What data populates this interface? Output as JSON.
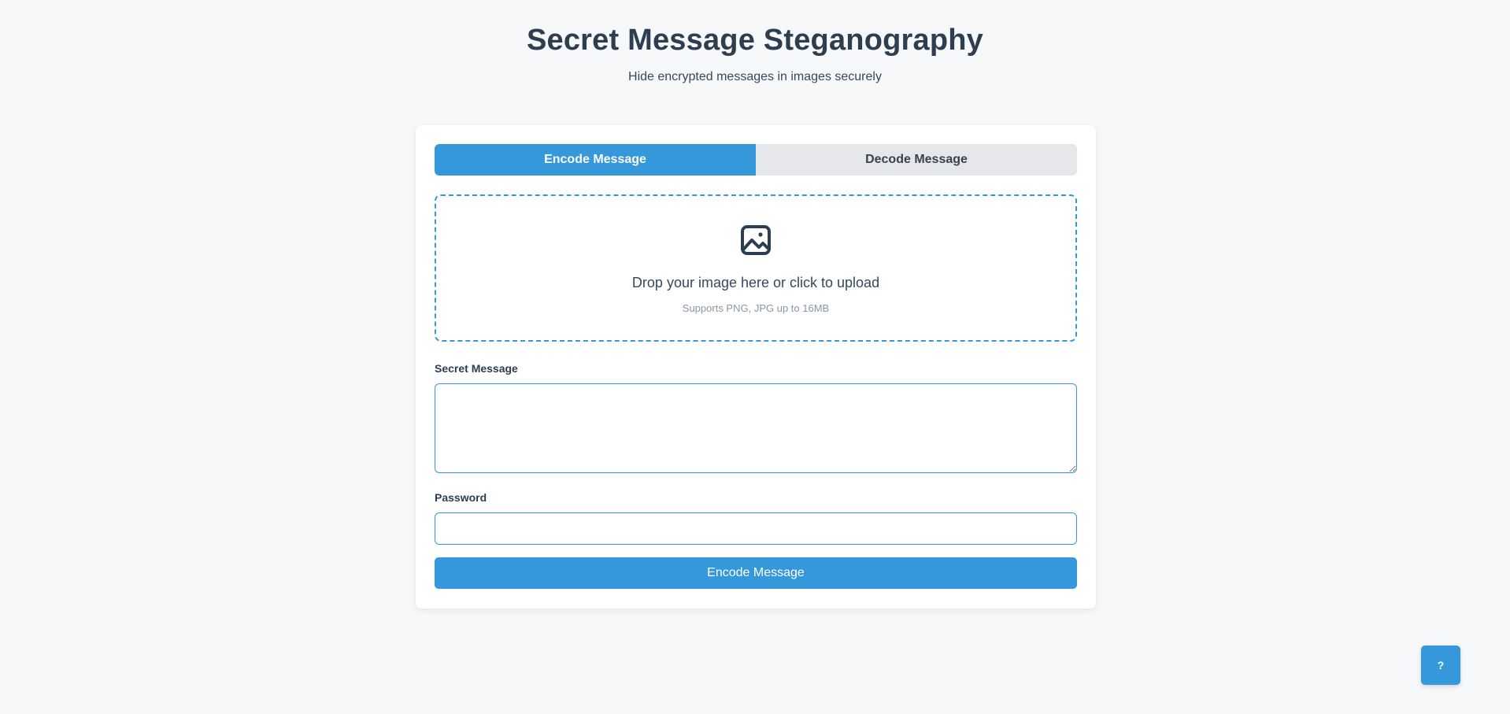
{
  "header": {
    "title": "Secret Message Steganography",
    "subtitle": "Hide encrypted messages in images securely"
  },
  "tabs": [
    {
      "label": "Encode Message",
      "active": true
    },
    {
      "label": "Decode Message",
      "active": false
    }
  ],
  "upload": {
    "icon": "image-icon",
    "text": "Drop your image here or click to upload",
    "hint": "Supports PNG, JPG up to 16MB"
  },
  "form": {
    "message_label": "Secret Message",
    "message_value": "",
    "password_label": "Password",
    "password_value": "",
    "submit_label": "Encode Message"
  },
  "help": {
    "label": "?"
  },
  "colors": {
    "accent": "#3498db",
    "text": "#2c3e50",
    "background": "#f7f8fa",
    "tab_inactive": "#e5e7eb"
  }
}
